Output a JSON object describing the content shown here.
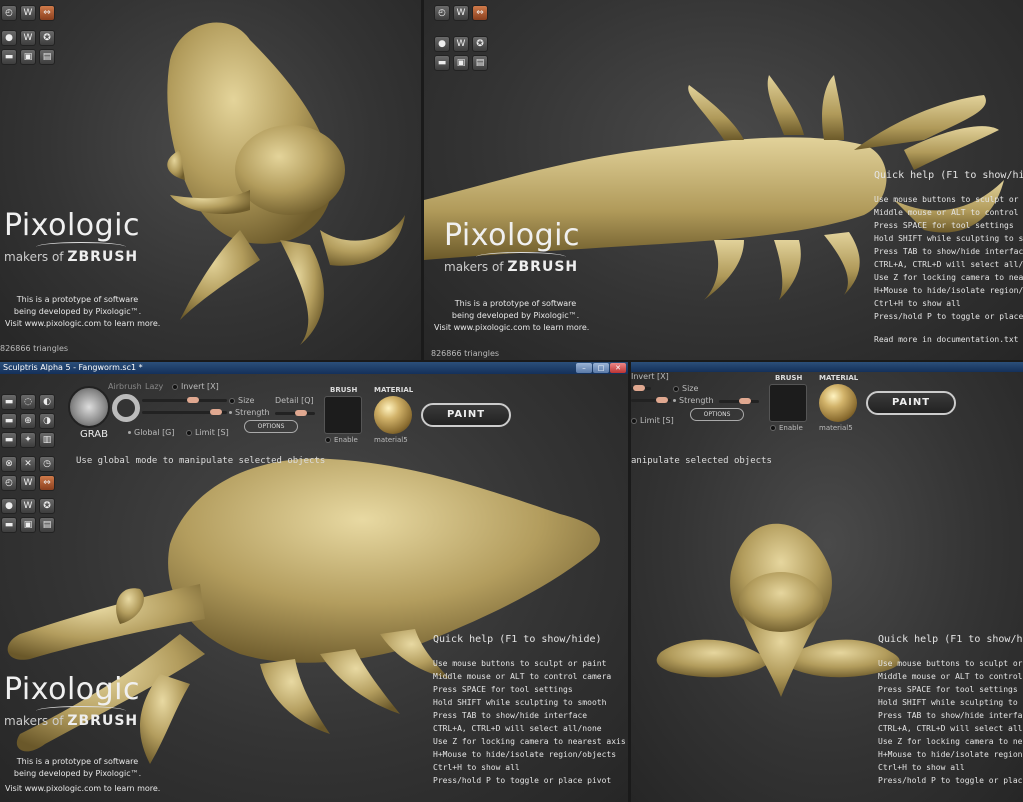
{
  "logo": {
    "name": "Pixologic",
    "makers": "makers of",
    "brand": "ZBRUSH"
  },
  "prototype_text": [
    "This is a prototype of software",
    "being developed by Pixologic™."
  ],
  "visit_text": "Visit www.pixologic.com to learn more.",
  "triangles": "826866 triangles",
  "window_title": "Sculptris Alpha 5 - Fangworm.sc1 *",
  "quick_help": {
    "title": "Quick help (F1 to show/hide)",
    "lines": [
      "Use mouse buttons to sculpt or paint",
      "Middle mouse or ALT to control camera",
      "Press SPACE for tool settings",
      "Hold SHIFT while sculpting to smooth",
      "Press TAB to show/hide interface",
      "CTRL+A, CTRL+D will select all/none",
      "Use Z for locking camera to nearest axis",
      "H+Mouse to hide/isolate region/objects",
      "Ctrl+H to show all",
      "Press/hold P to toggle or place pivot"
    ],
    "more": "Read more in documentation.txt"
  },
  "toolbar": {
    "airbrush": "Airbrush",
    "lazy": "Lazy",
    "invert": "Invert [X]",
    "size": "Size",
    "detail": "Detail [Q]",
    "strength": "Strength",
    "global": "Global [G]",
    "limit": "Limit [S]",
    "options": "OPTIONS",
    "grab": "GRAB",
    "brush": "BRUSH",
    "material": "MATERIAL",
    "enable": "Enable",
    "material_name": "material5",
    "paint": "PAINT"
  },
  "hint_full": "Use global mode to manipulate selected objects",
  "hint_partial": "anipulate selected objects",
  "colors": {
    "model": "#b7a364",
    "accent": "#c8693a",
    "bg": "#333333"
  }
}
